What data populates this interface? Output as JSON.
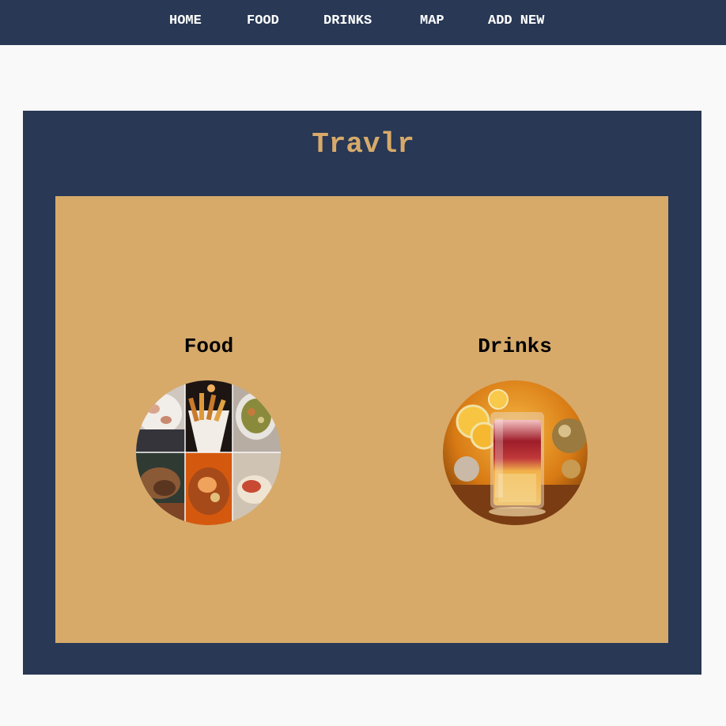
{
  "nav": {
    "items": [
      {
        "label": "HOME"
      },
      {
        "label": "FOOD"
      },
      {
        "label": "DRINKS"
      },
      {
        "label": "MAP"
      },
      {
        "label": "ADD NEW"
      }
    ]
  },
  "header": {
    "title": "Travlr"
  },
  "categories": [
    {
      "title": "Food",
      "image": "food-collage-image"
    },
    {
      "title": "Drinks",
      "image": "cocktail-image"
    }
  ],
  "colors": {
    "navy": "#283855",
    "gold": "#d7aa6a",
    "page_background": "#f9f9f9"
  }
}
